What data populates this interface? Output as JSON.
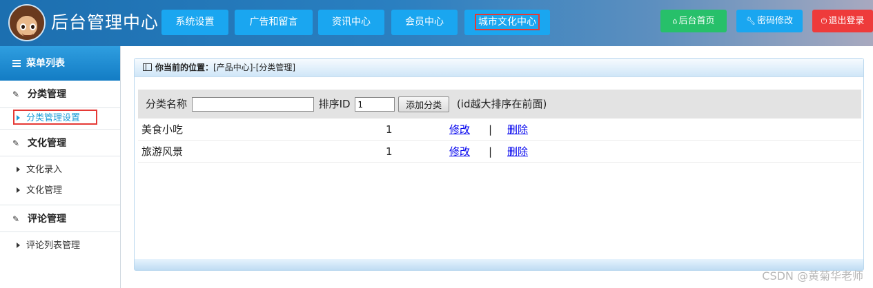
{
  "header": {
    "title": "后台管理中心",
    "nav": [
      {
        "label": "系统设置"
      },
      {
        "label": "广告和留言"
      },
      {
        "label": "资讯中心"
      },
      {
        "label": "会员中心"
      },
      {
        "label": "城市文化中心"
      }
    ],
    "buttons": {
      "home": "后台首页",
      "password": "密码修改",
      "logout": "退出登录"
    }
  },
  "sidebar": {
    "heading": "菜单列表",
    "groups": [
      {
        "label": "分类管理",
        "items": [
          {
            "label": "分类管理设置",
            "active": true
          }
        ]
      },
      {
        "label": "文化管理",
        "items": [
          {
            "label": "文化录入"
          },
          {
            "label": "文化管理"
          }
        ]
      },
      {
        "label": "评论管理",
        "items": [
          {
            "label": "评论列表管理"
          }
        ]
      }
    ]
  },
  "main": {
    "breadcrumb_label": "你当前的位置：",
    "breadcrumb_path": "[产品中心]-[分类管理]",
    "form": {
      "name_label": "分类名称",
      "name_value": "",
      "sort_label": "排序ID",
      "sort_value": "1",
      "add_button": "添加分类",
      "hint": "(id越大排序在前面)"
    },
    "rows": [
      {
        "name": "美食小吃",
        "sort": "1",
        "edit": "修改",
        "sep": "|",
        "delete": "删除"
      },
      {
        "name": "旅游风景",
        "sort": "1",
        "edit": "修改",
        "sep": "|",
        "delete": "删除"
      }
    ]
  },
  "watermark": "CSDN @黄菊华老师",
  "colors": {
    "accent": "#1aa6f0",
    "home_button": "#27c06a",
    "logout_button": "#ee3b3b",
    "highlight_frame": "#e53935"
  },
  "icons": {
    "menu": "list-icon",
    "group": "edit-icon",
    "item": "caret-right-icon",
    "home": "home-icon",
    "password": "wrench-icon",
    "logout": "power-icon",
    "panel": "window-icon"
  }
}
